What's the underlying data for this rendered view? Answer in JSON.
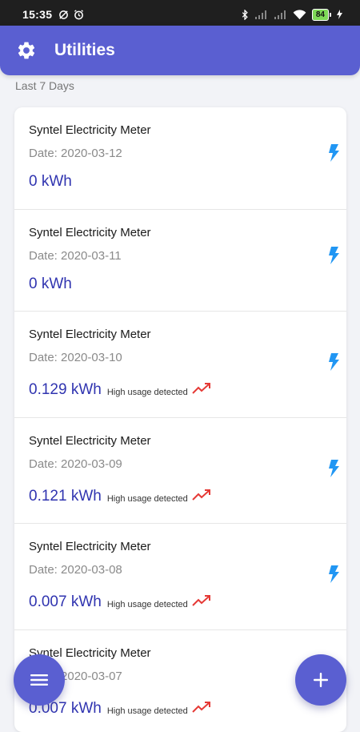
{
  "status_bar": {
    "time": "15:35",
    "battery": "84"
  },
  "header": {
    "title": "Utilities",
    "icon": "gear-icon"
  },
  "section": {
    "label": "Last 7 Days"
  },
  "readings": [
    {
      "title": "Syntel Electricity Meter",
      "date": "Date: 2020-03-12",
      "value": "0 kWh",
      "note": ""
    },
    {
      "title": "Syntel Electricity Meter",
      "date": "Date: 2020-03-11",
      "value": "0 kWh",
      "note": ""
    },
    {
      "title": "Syntel Electricity Meter",
      "date": "Date: 2020-03-10",
      "value": "0.129 kWh",
      "note": "High usage detected"
    },
    {
      "title": "Syntel Electricity Meter",
      "date": "Date: 2020-03-09",
      "value": "0.121 kWh",
      "note": "High usage detected"
    },
    {
      "title": "Syntel Electricity Meter",
      "date": "Date: 2020-03-08",
      "value": "0.007 kWh",
      "note": "High usage detected"
    },
    {
      "title": "Syntel Electricity Meter",
      "date": "Date: 2020-03-07",
      "value": "0.007 kWh",
      "note": "High usage detected"
    }
  ],
  "icons": {
    "reading_type": "lightning-bolt-icon",
    "high_usage": "trending-up-icon",
    "menu_fab": "menu-icon",
    "add_fab": "plus-icon"
  },
  "colors": {
    "primary": "#5a5fd1",
    "value_text": "#3034b0",
    "bolt": "#2196f3",
    "trend": "#e53935"
  }
}
